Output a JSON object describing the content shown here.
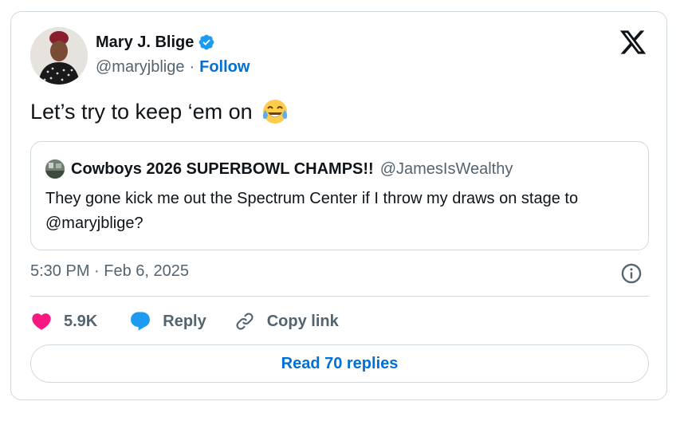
{
  "author": {
    "name": "Mary J. Blige",
    "handle": "@maryjblige",
    "separator": "·",
    "follow_label": "Follow",
    "verified": true
  },
  "tweet": {
    "text": "Let’s try to keep ‘em on",
    "emoji": "face-with-tears-of-joy"
  },
  "quote": {
    "name": "Cowboys 2026 SUPERBOWL CHAMPS!!",
    "handle": "@JamesIsWealthy",
    "text": "They gone kick me out the Spectrum Center if I throw my draws on stage to @maryjblige?"
  },
  "meta": {
    "timestamp": "5:30 PM · Feb 6, 2025"
  },
  "actions": {
    "like_count": "5.9K",
    "reply_label": "Reply",
    "copy_label": "Copy link"
  },
  "read_replies_label": "Read 70 replies",
  "colors": {
    "accent": "#006fd6",
    "verified": "#1d9bf0",
    "like": "#f91880",
    "text_secondary": "#536471",
    "border": "#cfd9de"
  },
  "icons": [
    "verified-badge-icon",
    "x-logo-icon",
    "info-icon",
    "heart-icon",
    "reply-bubble-icon",
    "link-icon"
  ]
}
